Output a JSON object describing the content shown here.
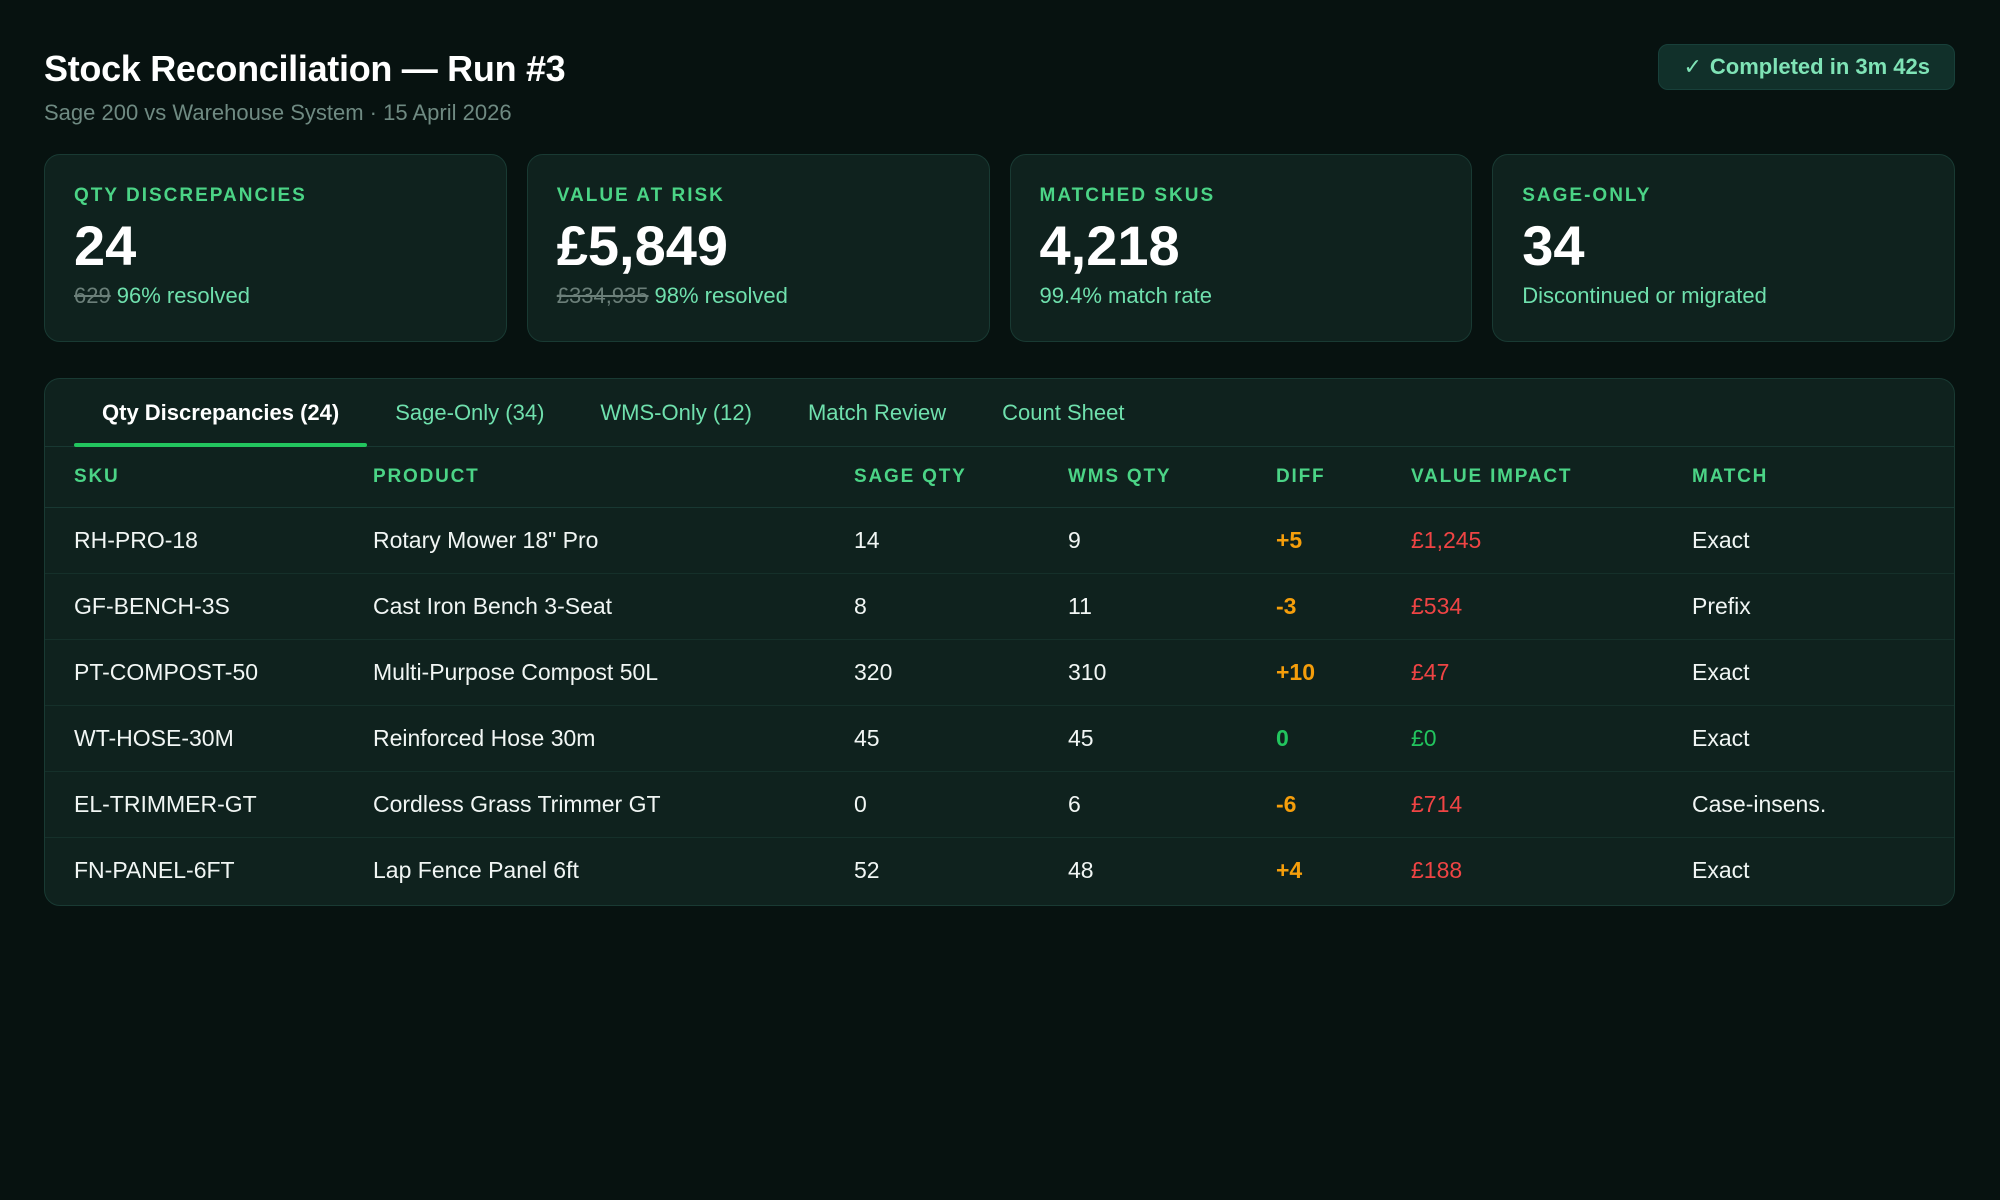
{
  "header": {
    "title": "Stock Reconciliation — Run #3",
    "subtitle": "Sage 200 vs Warehouse System · 15 April 2026",
    "status": "Completed in 3m 42s",
    "status_icon": "✓"
  },
  "kpis": [
    {
      "label": "QTY DISCREPANCIES",
      "value": "24",
      "previous": "629",
      "note": "96% resolved"
    },
    {
      "label": "VALUE AT RISK",
      "value": "£5,849",
      "previous": "£334,935",
      "note": "98% resolved"
    },
    {
      "label": "MATCHED SKUS",
      "value": "4,218",
      "previous": "",
      "note": "99.4% match rate"
    },
    {
      "label": "SAGE-ONLY",
      "value": "34",
      "previous": "",
      "note": "Discontinued or migrated"
    }
  ],
  "tabs": [
    {
      "label": "Qty Discrepancies (24)",
      "active": true
    },
    {
      "label": "Sage-Only (34)",
      "active": false
    },
    {
      "label": "WMS-Only (12)",
      "active": false
    },
    {
      "label": "Match Review",
      "active": false
    },
    {
      "label": "Count Sheet",
      "active": false
    }
  ],
  "table": {
    "columns": [
      "SKU",
      "PRODUCT",
      "SAGE QTY",
      "WMS QTY",
      "DIFF",
      "VALUE IMPACT",
      "MATCH"
    ],
    "rows": [
      {
        "sku": "RH-PRO-18",
        "product": "Rotary Mower 18\" Pro",
        "sage_qty": "14",
        "wms_qty": "9",
        "diff": "+5",
        "value_impact": "£1,245",
        "match": "Exact"
      },
      {
        "sku": "GF-BENCH-3S",
        "product": "Cast Iron Bench 3-Seat",
        "sage_qty": "8",
        "wms_qty": "11",
        "diff": "-3",
        "value_impact": "£534",
        "match": "Prefix"
      },
      {
        "sku": "PT-COMPOST-50",
        "product": "Multi-Purpose Compost 50L",
        "sage_qty": "320",
        "wms_qty": "310",
        "diff": "+10",
        "value_impact": "£47",
        "match": "Exact"
      },
      {
        "sku": "WT-HOSE-30M",
        "product": "Reinforced Hose 30m",
        "sage_qty": "45",
        "wms_qty": "45",
        "diff": "0",
        "value_impact": "£0",
        "match": "Exact"
      },
      {
        "sku": "EL-TRIMMER-GT",
        "product": "Cordless Grass Trimmer GT",
        "sage_qty": "0",
        "wms_qty": "6",
        "diff": "-6",
        "value_impact": "£714",
        "match": "Case-insens."
      },
      {
        "sku": "FN-PANEL-6FT",
        "product": "Lap Fence Panel 6ft",
        "sage_qty": "52",
        "wms_qty": "48",
        "diff": "+4",
        "value_impact": "£188",
        "match": "Exact"
      }
    ]
  },
  "colors": {
    "background": "#071210",
    "card": "#0f221e",
    "accent": "#22c55e",
    "warning": "#f59e0b",
    "danger": "#ef4444"
  }
}
